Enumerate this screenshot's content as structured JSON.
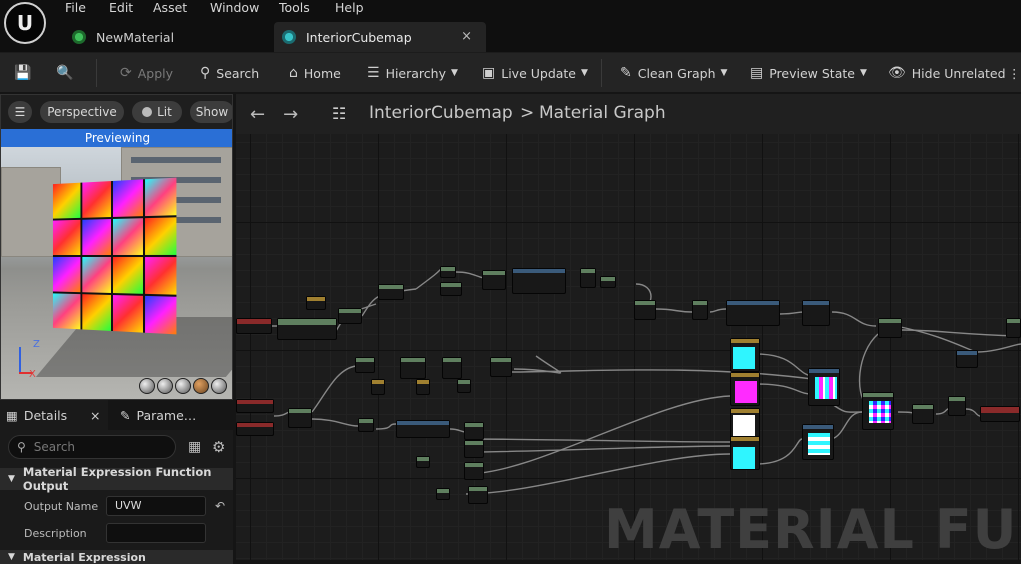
{
  "menu": [
    "File",
    "Edit",
    "Asset",
    "Window",
    "Tools",
    "Help"
  ],
  "tabs": [
    {
      "label": "NewMaterial",
      "active": false,
      "icon": "material-icon"
    },
    {
      "label": "InteriorCubemap",
      "active": true,
      "icon": "material-function-icon",
      "close": "×"
    }
  ],
  "toolbar": {
    "apply": "Apply",
    "search": "Search",
    "home": "Home",
    "hierarchy": "Hierarchy",
    "live_update": "Live Update",
    "clean_graph": "Clean Graph",
    "preview_state": "Preview State",
    "hide_unrelated": "Hide Unrelated"
  },
  "viewport": {
    "perspective": "Perspective",
    "lit": "Lit",
    "show": "Show",
    "previewing": "Previewing",
    "axis_z": "Z",
    "axis_x": "X"
  },
  "details": {
    "tab_details": "Details",
    "tab_params": "Parame…",
    "close": "×",
    "search_placeholder": "Search",
    "section": "Material Expression Function Output",
    "output_name_label": "Output Name",
    "output_name_value": "UVW",
    "description_label": "Description",
    "description_value": "",
    "section2": "Material Expression"
  },
  "graph": {
    "breadcrumb_asset": "InteriorCubemap",
    "breadcrumb_sep": ">",
    "breadcrumb_graph": "Material Graph",
    "watermark": "MATERIAL FUNC"
  },
  "colors": {
    "accent": "#2a6fd6",
    "tab_active": "#242424",
    "node_green": "#5f7f5f",
    "node_red": "#8a2a2a",
    "node_blue": "#3a5a7a"
  }
}
